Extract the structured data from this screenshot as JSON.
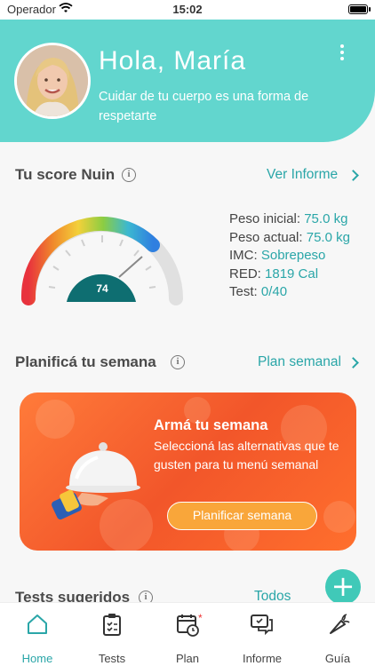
{
  "status_bar": {
    "carrier": "Operador",
    "time": "15:02"
  },
  "header": {
    "greeting": "Hola, María",
    "subtitle": "Cuidar de tu cuerpo es una forma de respetarte"
  },
  "score": {
    "title": "Tu score Nuin",
    "link": "Ver Informe",
    "value": "74",
    "stats": [
      {
        "label": "Peso inicial:",
        "value": "75.0 kg"
      },
      {
        "label": "Peso actual:",
        "value": "75.0 kg"
      },
      {
        "label": "IMC:",
        "value": "Sobrepeso"
      },
      {
        "label": "RED:",
        "value": "1819 Cal"
      },
      {
        "label": "Test:",
        "value": "0/40"
      }
    ]
  },
  "plan": {
    "title": "Planificá tu semana",
    "link": "Plan semanal",
    "card_title": "Armá tu semana",
    "card_text": "Seleccioná las alternativas que te gusten para tu menú semanal",
    "button": "Planificar semana"
  },
  "suggested": {
    "title": "Tests sugeridos",
    "link": "Todos"
  },
  "fab": {
    "label": "+"
  },
  "tabs": [
    {
      "label": "Home",
      "icon": "home-icon",
      "active": true
    },
    {
      "label": "Tests",
      "icon": "clipboard-icon"
    },
    {
      "label": "Plan",
      "icon": "calendar-icon"
    },
    {
      "label": "Informe",
      "icon": "chat-icon"
    },
    {
      "label": "Guía",
      "icon": "carrot-icon"
    }
  ],
  "colors": {
    "teal": "#62d6ce",
    "accent": "#2aa6a8",
    "orange": "#f2562a",
    "button": "#f9a63a"
  }
}
